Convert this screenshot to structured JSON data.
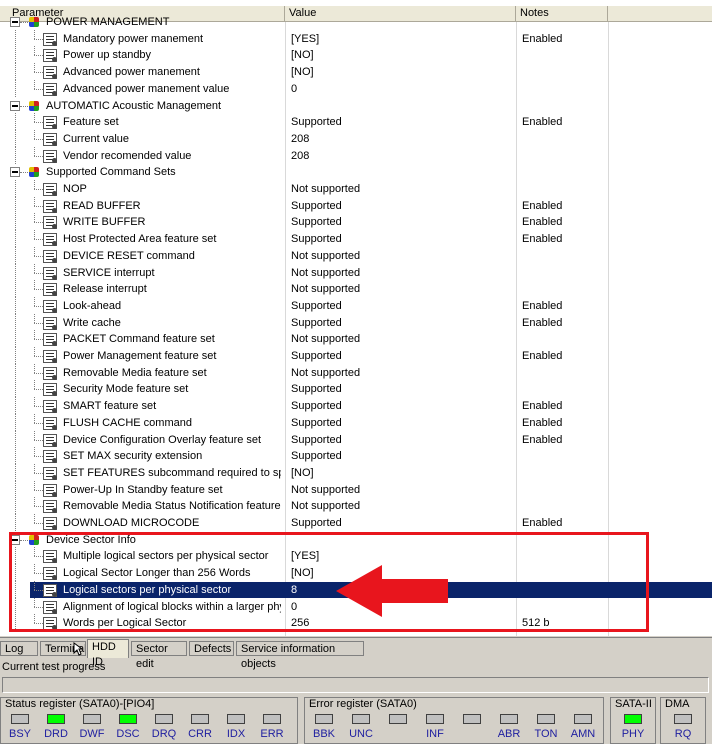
{
  "columns": {
    "parameter": "Parameter",
    "value": "Value",
    "notes": "Notes"
  },
  "rows": [
    {
      "level": 0,
      "name": "POWER MANAGEMENT",
      "value": "",
      "notes": ""
    },
    {
      "level": 1,
      "name": "Mandatory power manement",
      "value": "[YES]",
      "notes": "Enabled"
    },
    {
      "level": 1,
      "name": "Power up standby",
      "value": "[NO]",
      "notes": ""
    },
    {
      "level": 1,
      "name": "Advanced power manement",
      "value": "[NO]",
      "notes": ""
    },
    {
      "level": 1,
      "name": "Advanced power manement value",
      "value": "0",
      "notes": ""
    },
    {
      "level": 0,
      "name": "AUTOMATIC Acoustic Management",
      "value": "",
      "notes": ""
    },
    {
      "level": 1,
      "name": "Feature set",
      "value": "Supported",
      "notes": "Enabled"
    },
    {
      "level": 1,
      "name": "Current value",
      "value": "208",
      "notes": ""
    },
    {
      "level": 1,
      "name": "Vendor recomended value",
      "value": "208",
      "notes": ""
    },
    {
      "level": 0,
      "name": "Supported Command Sets",
      "value": "",
      "notes": ""
    },
    {
      "level": 1,
      "name": "NOP",
      "value": "Not supported",
      "notes": ""
    },
    {
      "level": 1,
      "name": "READ BUFFER",
      "value": "Supported",
      "notes": "Enabled"
    },
    {
      "level": 1,
      "name": "WRITE BUFFER",
      "value": "Supported",
      "notes": "Enabled"
    },
    {
      "level": 1,
      "name": "Host Protected Area feature set",
      "value": "Supported",
      "notes": "Enabled"
    },
    {
      "level": 1,
      "name": "DEVICE RESET command",
      "value": "Not supported",
      "notes": ""
    },
    {
      "level": 1,
      "name": "SERVICE interrupt",
      "value": "Not supported",
      "notes": ""
    },
    {
      "level": 1,
      "name": "Release interrupt",
      "value": "Not supported",
      "notes": ""
    },
    {
      "level": 1,
      "name": "Look-ahead",
      "value": "Supported",
      "notes": "Enabled"
    },
    {
      "level": 1,
      "name": "Write cache",
      "value": "Supported",
      "notes": "Enabled"
    },
    {
      "level": 1,
      "name": "PACKET Command feature set",
      "value": "Not supported",
      "notes": ""
    },
    {
      "level": 1,
      "name": "Power Management feature set",
      "value": "Supported",
      "notes": "Enabled"
    },
    {
      "level": 1,
      "name": "Removable Media feature set",
      "value": "Not supported",
      "notes": ""
    },
    {
      "level": 1,
      "name": "Security Mode feature set",
      "value": "Supported",
      "notes": ""
    },
    {
      "level": 1,
      "name": "SMART feature set",
      "value": "Supported",
      "notes": "Enabled"
    },
    {
      "level": 1,
      "name": "FLUSH CACHE command",
      "value": "Supported",
      "notes": "Enabled"
    },
    {
      "level": 1,
      "name": "Device Configuration Overlay feature set",
      "value": "Supported",
      "notes": "Enabled"
    },
    {
      "level": 1,
      "name": "SET MAX security extension",
      "value": "Supported",
      "notes": ""
    },
    {
      "level": 1,
      "name": "SET FEATURES subcommand required to spinu...",
      "value": "[NO]",
      "notes": ""
    },
    {
      "level": 1,
      "name": "Power-Up In Standby feature set",
      "value": "Not supported",
      "notes": ""
    },
    {
      "level": 1,
      "name": "Removable Media Status Notification feature set",
      "value": "Not supported",
      "notes": ""
    },
    {
      "level": 1,
      "name": "DOWNLOAD MICROCODE",
      "value": "Supported",
      "notes": "Enabled"
    },
    {
      "level": 0,
      "name": "Device Sector Info",
      "value": "",
      "notes": ""
    },
    {
      "level": 1,
      "name": "Multiple logical sectors per physical sector",
      "value": "[YES]",
      "notes": ""
    },
    {
      "level": 1,
      "name": "Logical Sector Longer than 256 Words",
      "value": "[NO]",
      "notes": ""
    },
    {
      "level": 1,
      "name": "Logical sectors per physical sector",
      "value": "8",
      "notes": "",
      "selected": true
    },
    {
      "level": 1,
      "name": "Alignment of logical blocks within a larger phys...",
      "value": "0",
      "notes": ""
    },
    {
      "level": 1,
      "name": "Words per Logical Sector",
      "value": "256",
      "notes": "512 b"
    }
  ],
  "tabs": [
    "Log",
    "Terminal",
    "HDD ID",
    "Sector edit",
    "Defects",
    "Service information objects"
  ],
  "active_tab": "HDD ID",
  "progress_label": "Current test progress",
  "status_register": {
    "title": "Status register (SATA0)-[PIO4]",
    "leds": [
      {
        "label": "BSY",
        "on": false
      },
      {
        "label": "DRD",
        "on": true
      },
      {
        "label": "DWF",
        "on": false
      },
      {
        "label": "DSC",
        "on": true
      },
      {
        "label": "DRQ",
        "on": false
      },
      {
        "label": "CRR",
        "on": false
      },
      {
        "label": "IDX",
        "on": false
      },
      {
        "label": "ERR",
        "on": false
      }
    ]
  },
  "error_register": {
    "title": "Error register (SATA0)",
    "leds": [
      {
        "label": "BBK",
        "on": false
      },
      {
        "label": "UNC",
        "on": false
      },
      {
        "label": "",
        "on": false
      },
      {
        "label": "INF",
        "on": false
      },
      {
        "label": "",
        "on": false
      },
      {
        "label": "ABR",
        "on": false
      },
      {
        "label": "TON",
        "on": false
      },
      {
        "label": "AMN",
        "on": false
      }
    ]
  },
  "sata_register": {
    "title": "SATA-II",
    "leds": [
      {
        "label": "PHY",
        "on": true
      }
    ]
  },
  "dma_register": {
    "title": "DMA",
    "leds": [
      {
        "label": "RQ",
        "on": false
      }
    ]
  },
  "colors": {
    "highlight": "#e8151d",
    "selection": "#0a246a",
    "led_on": "#00ff00"
  }
}
